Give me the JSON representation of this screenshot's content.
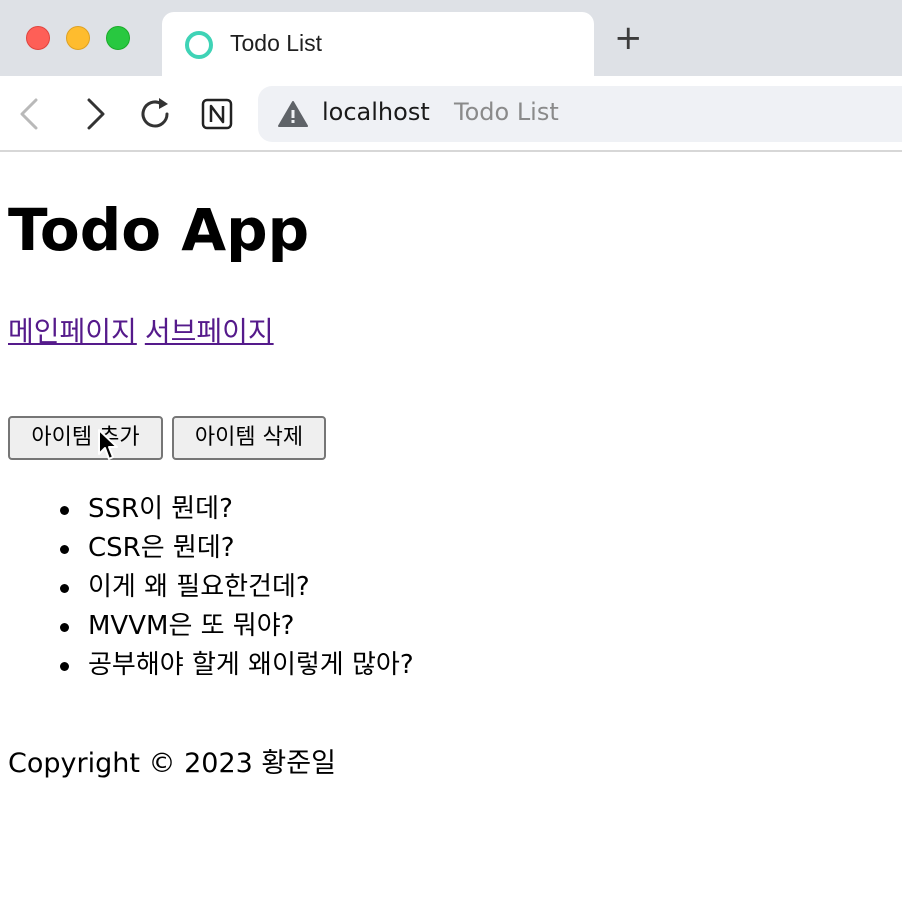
{
  "browser": {
    "tab_title": "Todo List",
    "new_tab_label": "+",
    "address_host": "localhost",
    "address_title": "Todo List",
    "icons": {
      "back": "chevron-left-icon",
      "forward": "chevron-right-icon",
      "reload": "reload-icon",
      "extension": "notion-icon",
      "security": "warning-icon",
      "favicon": "ring-icon"
    }
  },
  "page": {
    "heading": "Todo App",
    "nav": {
      "main_link": "메인페이지",
      "sub_link": "서브페이지"
    },
    "buttons": {
      "add_label": "아이템 추가",
      "delete_label": "아이템 삭제"
    },
    "todos": [
      "SSR이 뭔데?",
      "CSR은 뭔데?",
      "이게 왜 필요한건데?",
      "MVVM은 또 뭐야?",
      "공부해야 할게 왜이렇게 많아?"
    ],
    "footer": "Copyright © 2023 황준일"
  },
  "colors": {
    "tabstrip_bg": "#dee1e6",
    "link_visited": "#551a8b",
    "favicon_ring": "#3fd3b6"
  }
}
